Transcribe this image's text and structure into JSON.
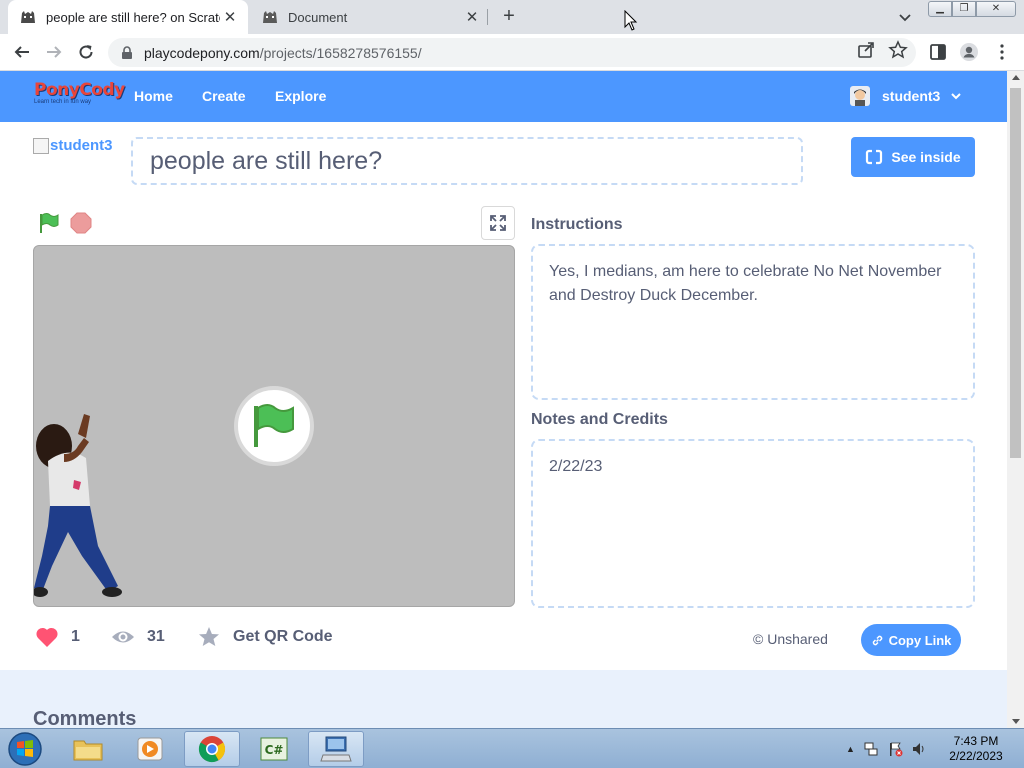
{
  "browser": {
    "tabs": [
      {
        "title": "people are still here? on Scratch",
        "active": true
      },
      {
        "title": "Document",
        "active": false
      }
    ],
    "url_host": "playcodepony.com",
    "url_path": "/projects/1658278576155/",
    "new_tab_label": "+",
    "close_label": "✕"
  },
  "site": {
    "logo_text": "PonyCody",
    "logo_tagline": "Learn tech in fun way",
    "nav": {
      "home": "Home",
      "create": "Create",
      "explore": "Explore"
    },
    "username": "student3"
  },
  "project": {
    "author_image_alt": "student3",
    "title": "people are still here?",
    "see_inside_label": "See inside",
    "instructions_label": "Instructions",
    "instructions": "Yes, I medians, am here to celebrate No Net November and Destroy Duck December.",
    "notes_label": "Notes and Credits",
    "notes": "2/22/23",
    "loves": "1",
    "views": "31",
    "qr_label": "Get QR Code",
    "share_status": "© Unshared",
    "copy_link_label": "Copy Link"
  },
  "comments": {
    "heading": "Comments"
  },
  "taskbar": {
    "time": "7:43 PM",
    "date": "2/22/2023",
    "apps": [
      "file-explorer",
      "media-player",
      "chrome",
      "csharp-ide",
      "remote-desktop"
    ]
  },
  "colors": {
    "brand_blue": "#4c97ff",
    "text": "#575e75",
    "love_red": "#ff5373",
    "green_flag": "#4cbf56"
  }
}
